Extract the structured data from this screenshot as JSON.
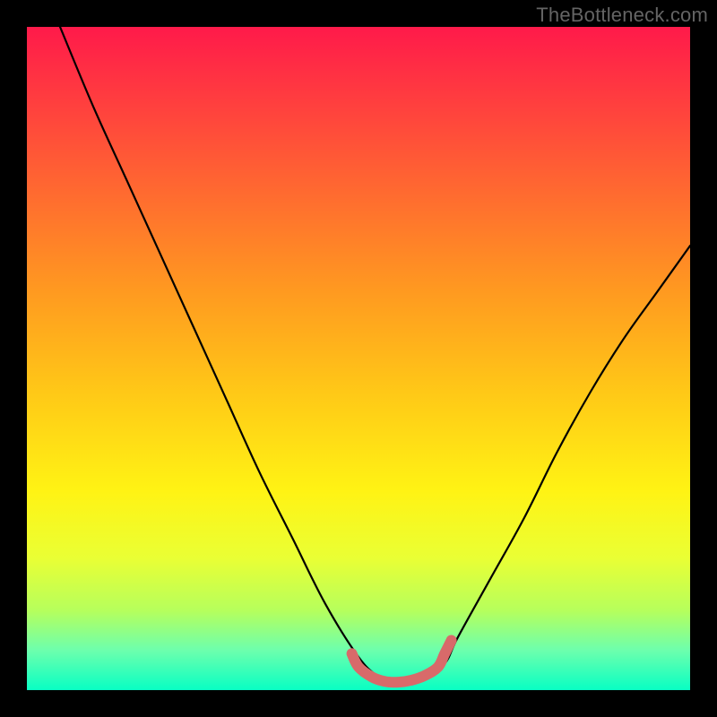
{
  "watermark": "TheBottleneck.com",
  "chart_data": {
    "type": "line",
    "title": "",
    "xlabel": "",
    "ylabel": "",
    "xlim": [
      0,
      100
    ],
    "ylim": [
      0,
      100
    ],
    "series": [
      {
        "name": "bottleneck-curve",
        "x": [
          5,
          10,
          15,
          20,
          25,
          30,
          35,
          40,
          45,
          50,
          53,
          55,
          58,
          60,
          63,
          65,
          70,
          75,
          80,
          85,
          90,
          95,
          100
        ],
        "values": [
          100,
          88,
          77,
          66,
          55,
          44,
          33,
          23,
          13,
          5,
          2,
          1,
          1,
          2,
          4,
          8,
          17,
          26,
          36,
          45,
          53,
          60,
          67
        ]
      },
      {
        "name": "optimal-range-marker",
        "x": [
          49,
          50,
          52,
          54,
          56,
          58,
          60,
          62,
          63,
          64
        ],
        "values": [
          5.5,
          3.5,
          2.0,
          1.3,
          1.2,
          1.5,
          2.2,
          3.5,
          5.5,
          7.5
        ]
      }
    ]
  }
}
